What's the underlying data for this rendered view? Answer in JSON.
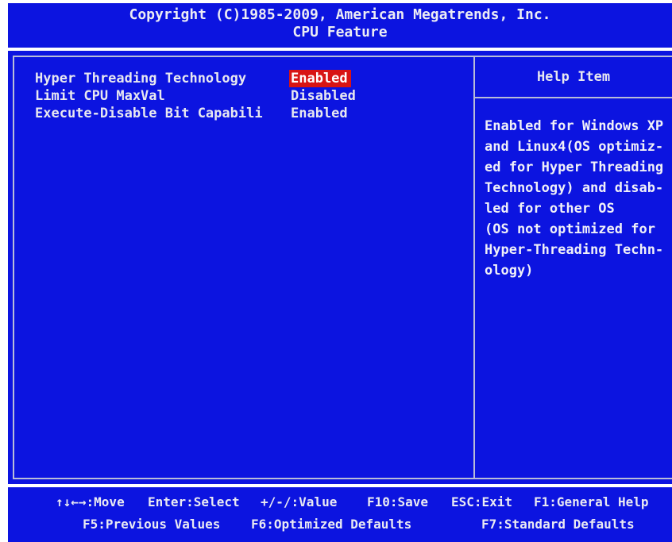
{
  "header": {
    "copyright": "Copyright (C)1985-2009, American Megatrends, Inc.",
    "page_title": "CPU Feature"
  },
  "options": [
    {
      "label": "Hyper Threading Technology",
      "value": "Enabled",
      "selected": true
    },
    {
      "label": "Limit CPU MaxVal",
      "value": "Disabled",
      "selected": false
    },
    {
      "label": "Execute-Disable Bit Capabili",
      "value": "Enabled",
      "selected": false
    }
  ],
  "help": {
    "title": "Help Item",
    "text": "Enabled for Windows XP\nand Linux4(OS optimiz-\ned for Hyper Threading\nTechnology) and disab-\nled for other OS\n(OS not optimized for\nHyper-Threading Techn-\nology)"
  },
  "footer": {
    "move": "↑↓←→:Move",
    "enter": "Enter:Select",
    "value": "+/-/:Value",
    "save": "F10:Save",
    "exit": "ESC:Exit",
    "general_help": "F1:General Help",
    "previous": "F5:Previous Values",
    "optimized": "F6:Optimized Defaults",
    "standard": "F7:Standard Defaults"
  },
  "colors": {
    "background": "#0c14e0",
    "highlight": "#d81414",
    "text": "#e8e8f0"
  }
}
